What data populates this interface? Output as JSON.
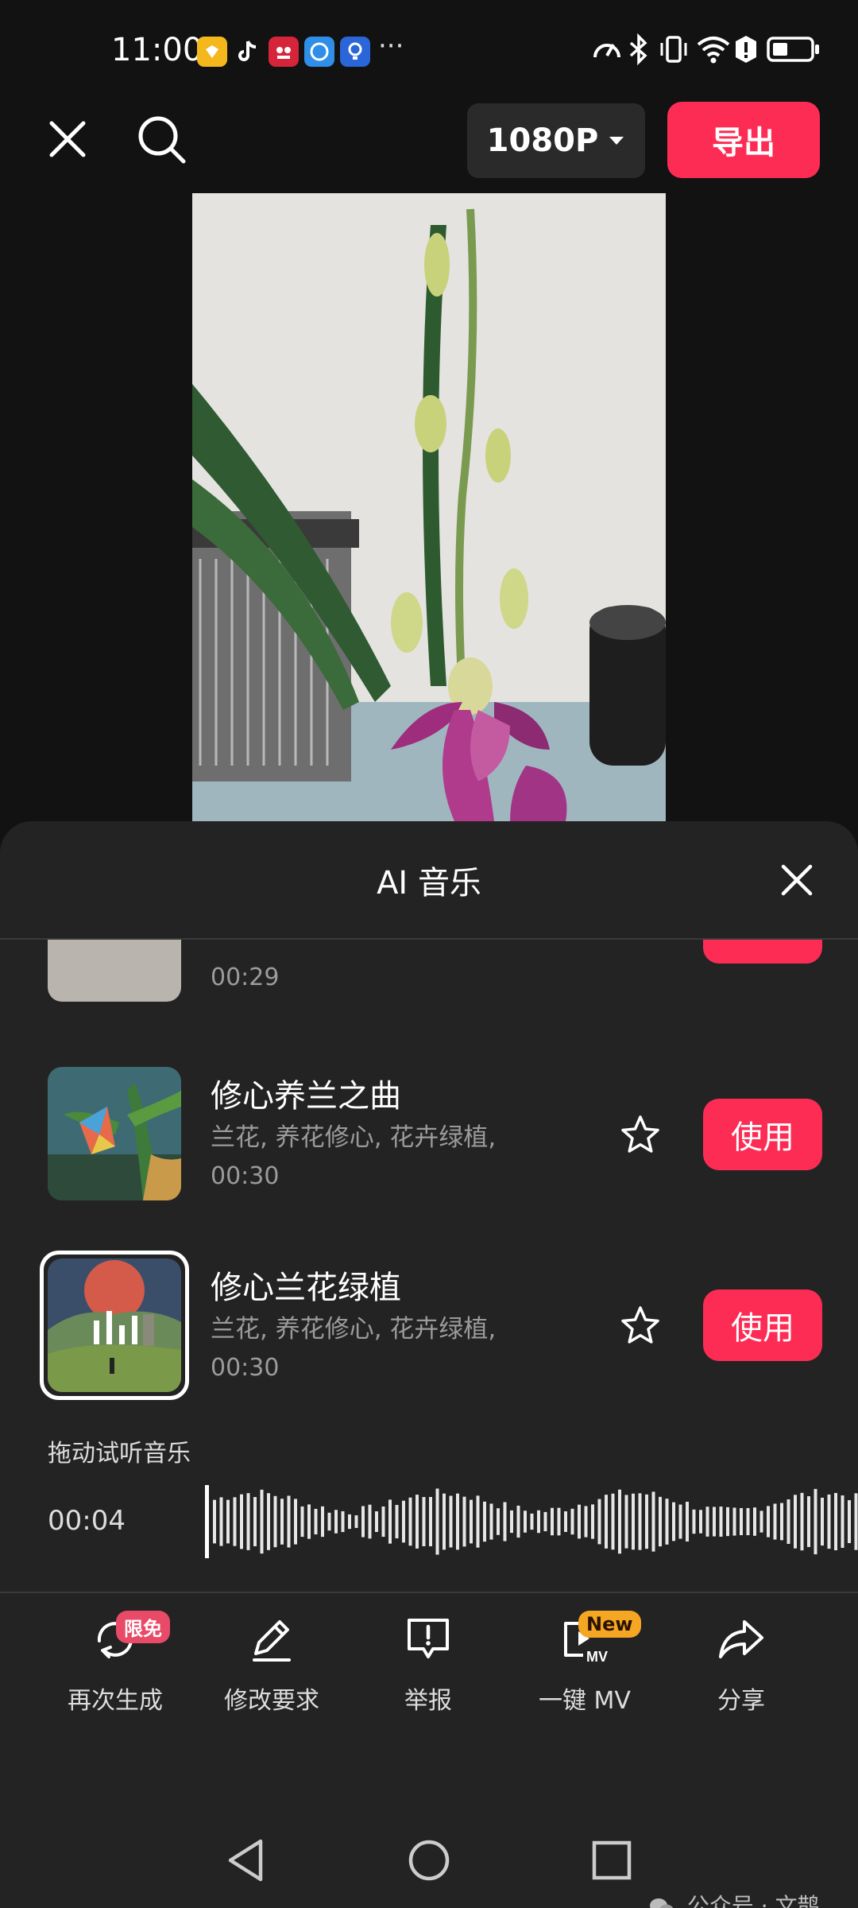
{
  "status_bar": {
    "time": "11:00",
    "more_apps": "···",
    "apps": [
      {
        "name": "yellow-app-icon",
        "color": "#f5b81c"
      },
      {
        "name": "tiktok-icon",
        "color": "#121212"
      },
      {
        "name": "red-app-icon",
        "color": "#d6243a"
      },
      {
        "name": "blue-app-icon",
        "color": "#2f8ee8"
      },
      {
        "name": "bulb-app-icon",
        "color": "#2a66d8"
      }
    ]
  },
  "toolbar": {
    "resolution": "1080P",
    "export_label": "导出"
  },
  "sheet": {
    "title": "AI 音乐",
    "tracks": [
      {
        "duration": "00:29"
      },
      {
        "title": "修心养兰之曲",
        "tags": "兰花, 养花修心, 花卉绿植,",
        "duration": "00:30",
        "use_label": "使用"
      },
      {
        "title": "修心兰花绿植",
        "tags": "兰花, 养花修心, 花卉绿植,",
        "duration": "00:30",
        "use_label": "使用"
      }
    ],
    "scrub_hint": "拖动试听音乐",
    "current_time": "00:04"
  },
  "actions": [
    {
      "label": "再次生成",
      "badge": "限免",
      "icon": "regenerate-icon"
    },
    {
      "label": "修改要求",
      "icon": "edit-icon"
    },
    {
      "label": "举报",
      "icon": "report-icon"
    },
    {
      "label": "一键 MV",
      "badge": "New",
      "icon": "mv-icon",
      "icon_text": "MV"
    },
    {
      "label": "分享",
      "icon": "share-icon"
    }
  ],
  "colors": {
    "accent": "#fd2c55",
    "sheet_bg": "#232323",
    "new_badge": "#f5a623"
  },
  "watermark": "公众号 · 文鹊"
}
